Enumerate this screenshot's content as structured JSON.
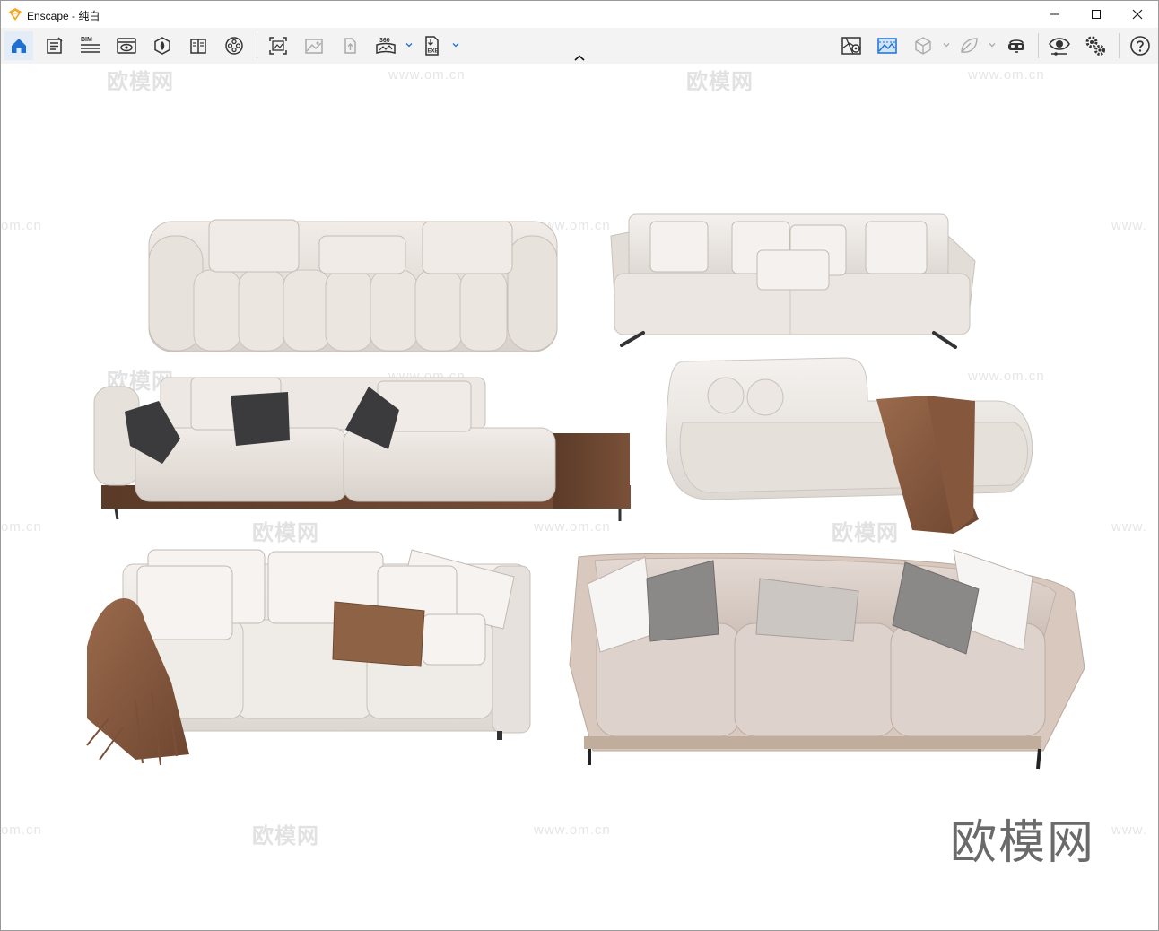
{
  "window": {
    "app_name": "Enscape",
    "separator": " - ",
    "document_name": "纯白",
    "accent_color": "#1e6fd1"
  },
  "toolbar": {
    "left_tools": [
      {
        "name": "home-icon",
        "active": true
      },
      {
        "name": "notes-icon"
      },
      {
        "name": "bim-icon",
        "label": "BIM"
      },
      {
        "name": "view-icon"
      },
      {
        "name": "asset-library-icon"
      },
      {
        "name": "material-editor-icon"
      },
      {
        "name": "video-editor-icon"
      },
      {
        "name": "screenshot-icon"
      },
      {
        "name": "batch-render-icon"
      },
      {
        "name": "upload-icon"
      },
      {
        "name": "panorama-360-icon",
        "label": "360"
      },
      {
        "name": "export-exe-icon",
        "label": "EXE"
      }
    ],
    "right_tools": [
      {
        "name": "map-icon"
      },
      {
        "name": "atmosphere-icon"
      },
      {
        "name": "cube-icon"
      },
      {
        "name": "leaf-icon"
      },
      {
        "name": "vr-headset-icon"
      },
      {
        "name": "visual-settings-icon"
      },
      {
        "name": "settings-icon"
      },
      {
        "name": "help-icon"
      }
    ]
  },
  "viewport": {
    "watermarks": [
      "欧模网",
      "www.om.cn",
      "om.cn",
      "www."
    ],
    "brand_text": "欧模网"
  }
}
